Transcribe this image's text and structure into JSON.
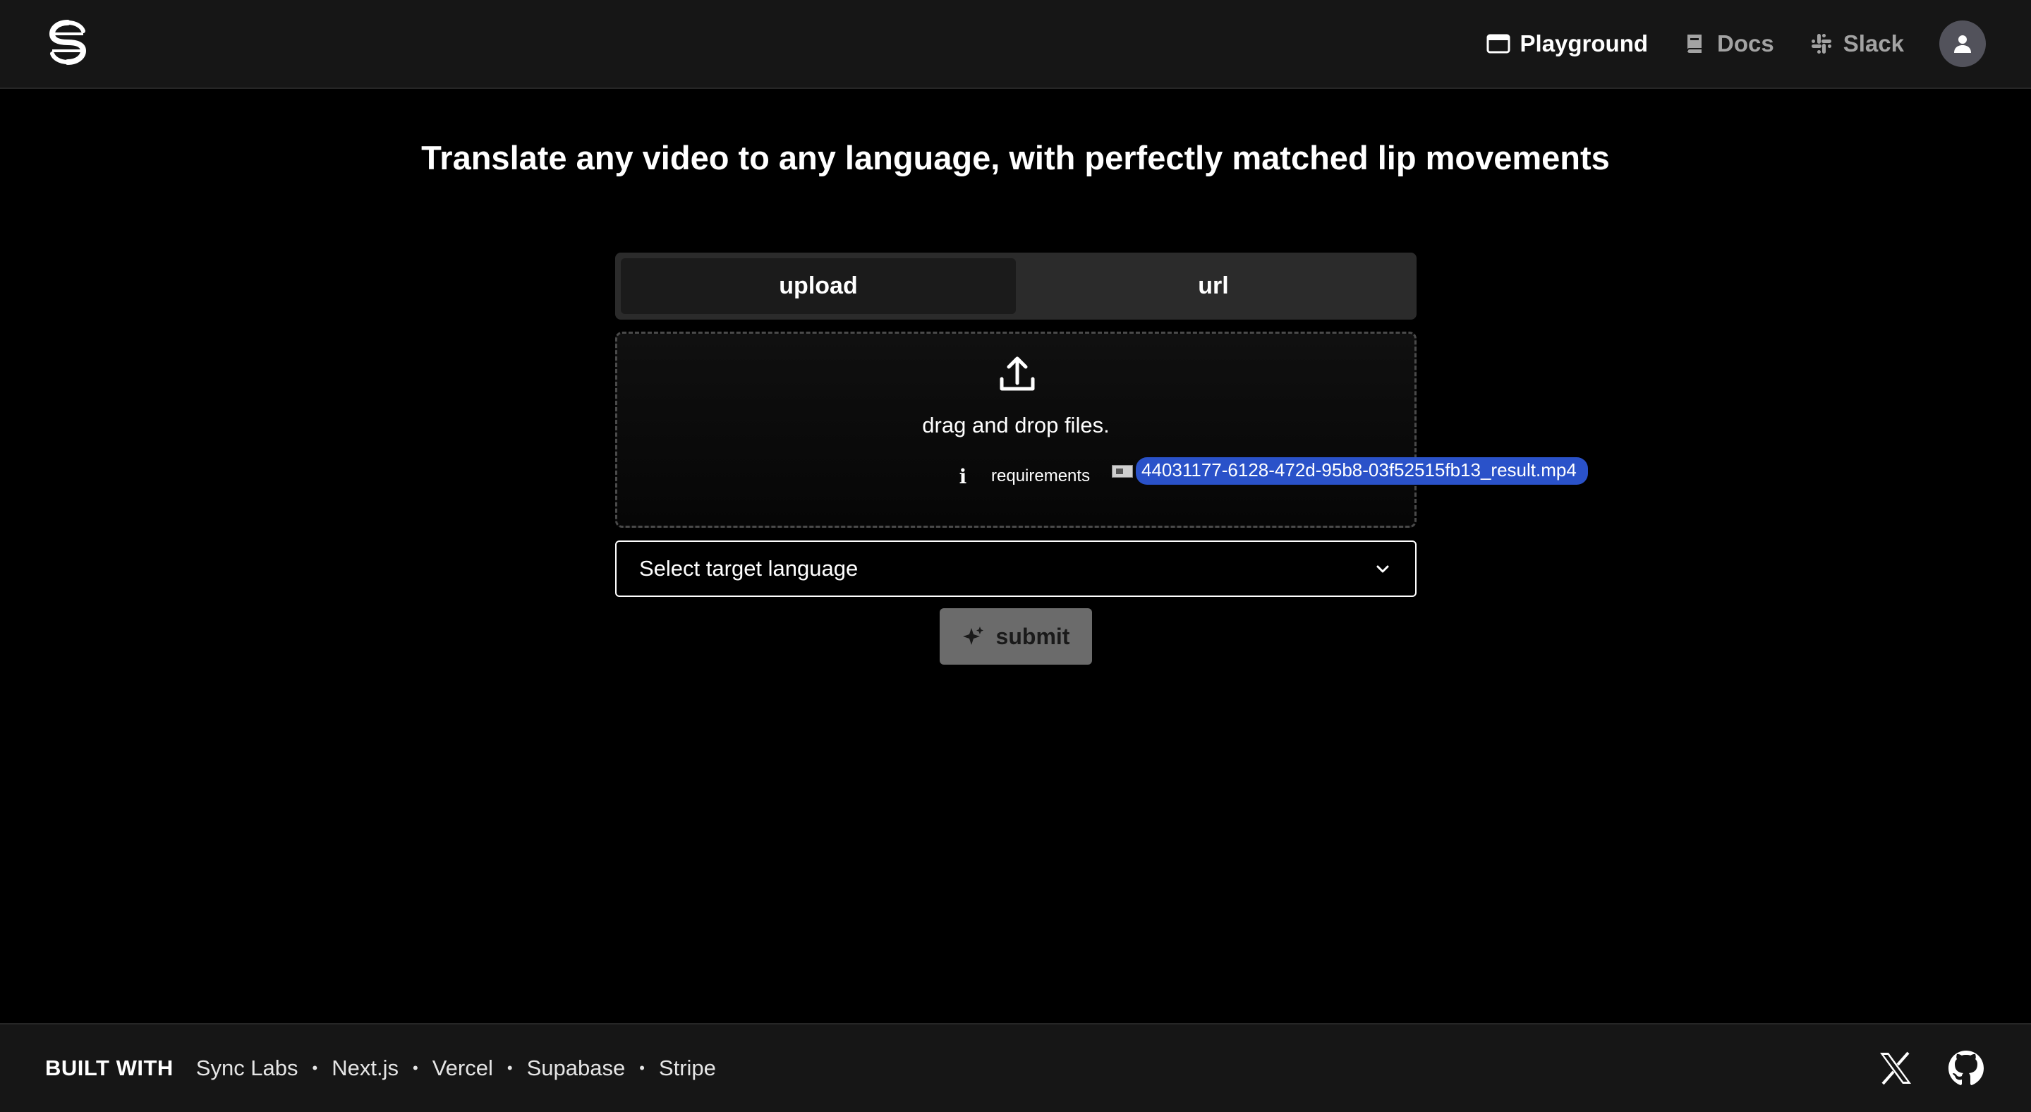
{
  "header": {
    "nav": [
      {
        "label": "Playground",
        "icon": "window-icon",
        "active": true
      },
      {
        "label": "Docs",
        "icon": "book-icon",
        "active": false
      },
      {
        "label": "Slack",
        "icon": "slack-icon",
        "active": false
      }
    ],
    "avatar_icon": "user-icon"
  },
  "main": {
    "headline": "Translate any video to any language, with perfectly matched lip movements",
    "tabs": [
      {
        "label": "upload",
        "active": true
      },
      {
        "label": "url",
        "active": false
      }
    ],
    "dropzone": {
      "text": "drag and drop files.",
      "requirements_label": "requirements"
    },
    "drag_file": "44031177-6128-472d-95b8-03f52515fb13_result.mp4",
    "select": {
      "value": "Select target language"
    },
    "submit_label": "submit"
  },
  "footer": {
    "built_with": "BUILT WITH",
    "links": [
      "Sync Labs",
      "Next.js",
      "Vercel",
      "Supabase",
      "Stripe"
    ],
    "social_icons": [
      "x-icon",
      "github-icon"
    ]
  },
  "colors": {
    "background": "#000000",
    "header_bg": "#161616",
    "drag_highlight": "#2a52c9",
    "submit_bg": "#6b6b6b"
  }
}
